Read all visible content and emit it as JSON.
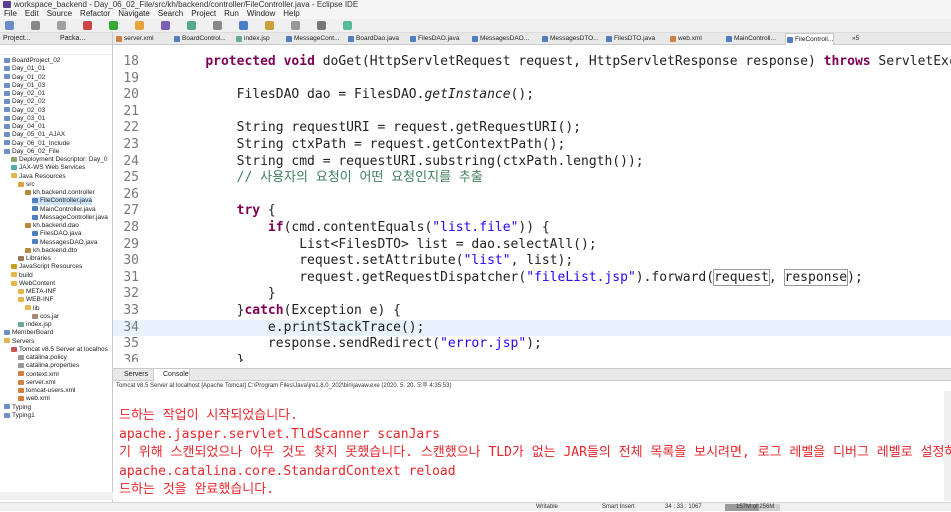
{
  "window": {
    "title": "workspace_backend - Day_06_02_File/src/kh/backend/controller/FileController.java - Eclipse IDE"
  },
  "menubar": [
    "File",
    "Edit",
    "Source",
    "Refactor",
    "Navigate",
    "Search",
    "Project",
    "Run",
    "Window",
    "Help"
  ],
  "left_panel": {
    "tab_project": "Project...",
    "tab_package": "Packa...",
    "tree": [
      {
        "label": "BoardProject_02",
        "depth": 0,
        "icon": "project-icon"
      },
      {
        "label": "Day_01_01",
        "depth": 0,
        "icon": "project-icon"
      },
      {
        "label": "Day_01_02",
        "depth": 0,
        "icon": "project-icon"
      },
      {
        "label": "Day_01_03",
        "depth": 0,
        "icon": "project-icon"
      },
      {
        "label": "Day_02_01",
        "depth": 0,
        "icon": "project-icon"
      },
      {
        "label": "Day_02_02",
        "depth": 0,
        "icon": "project-icon"
      },
      {
        "label": "Day_02_03",
        "depth": 0,
        "icon": "project-icon"
      },
      {
        "label": "Day_03_01",
        "depth": 0,
        "icon": "project-icon"
      },
      {
        "label": "Day_04_01",
        "depth": 0,
        "icon": "project-icon"
      },
      {
        "label": "Day_05_01_AJAX",
        "depth": 0,
        "icon": "project-icon"
      },
      {
        "label": "Day_06_01_Include",
        "depth": 0,
        "icon": "project-icon"
      },
      {
        "label": "Day_06_02_File",
        "depth": 0,
        "icon": "project-icon"
      },
      {
        "label": "Deployment Descriptor: Day_0",
        "depth": 1,
        "icon": "descriptor-icon"
      },
      {
        "label": "JAX-WS Web Services",
        "depth": 1,
        "icon": "webservice-icon"
      },
      {
        "label": "Java Resources",
        "depth": 1,
        "icon": "folder-icon"
      },
      {
        "label": "src",
        "depth": 2,
        "icon": "source-folder-icon"
      },
      {
        "label": "kh.backend.controller",
        "depth": 3,
        "icon": "package-icon"
      },
      {
        "label": "FileController.java",
        "depth": 4,
        "icon": "java-file-icon",
        "selected": true
      },
      {
        "label": "MainController.java",
        "depth": 4,
        "icon": "java-file-icon"
      },
      {
        "label": "MessageController.java",
        "depth": 4,
        "icon": "java-file-icon"
      },
      {
        "label": "kh.backend.dao",
        "depth": 3,
        "icon": "package-icon"
      },
      {
        "label": "FilesDAO.java",
        "depth": 4,
        "icon": "java-file-icon"
      },
      {
        "label": "MessagesDAO.java",
        "depth": 4,
        "icon": "java-file-icon"
      },
      {
        "label": "kh.backend.dto",
        "depth": 3,
        "icon": "package-icon"
      },
      {
        "label": "Libraries",
        "depth": 2,
        "icon": "library-icon"
      },
      {
        "label": "JavaScript Resources",
        "depth": 1,
        "icon": "js-icon"
      },
      {
        "label": "build",
        "depth": 1,
        "icon": "folder-icon"
      },
      {
        "label": "WebContent",
        "depth": 1,
        "icon": "folder-icon"
      },
      {
        "label": "META-INF",
        "depth": 2,
        "icon": "folder-icon"
      },
      {
        "label": "WEB-INF",
        "depth": 2,
        "icon": "folder-icon"
      },
      {
        "label": "lib",
        "depth": 3,
        "icon": "folder-icon"
      },
      {
        "label": "cos.jar",
        "depth": 4,
        "icon": "jar-icon"
      },
      {
        "label": "index.jsp",
        "depth": 2,
        "icon": "jsp-icon"
      },
      {
        "label": "MemberBoard",
        "depth": 0,
        "icon": "project-icon"
      },
      {
        "label": "Servers",
        "depth": 0,
        "icon": "folder-icon"
      },
      {
        "label": "Tomcat v8.5 Server at localhos",
        "depth": 1,
        "icon": "server-icon"
      },
      {
        "label": "catalina.policy",
        "depth": 2,
        "icon": "file-icon"
      },
      {
        "label": "catalina.properties",
        "depth": 2,
        "icon": "file-icon"
      },
      {
        "label": "context.xml",
        "depth": 2,
        "icon": "xml-icon"
      },
      {
        "label": "server.xml",
        "depth": 2,
        "icon": "xml-icon"
      },
      {
        "label": "tomcat-users.xml",
        "depth": 2,
        "icon": "xml-icon"
      },
      {
        "label": "web.xml",
        "depth": 2,
        "icon": "xml-icon"
      },
      {
        "label": "Typing",
        "depth": 0,
        "icon": "project-icon"
      },
      {
        "label": "Typing1",
        "depth": 0,
        "icon": "project-icon"
      }
    ]
  },
  "editor_tabs": [
    {
      "label": "server.xml",
      "icon": "xml-icon"
    },
    {
      "label": "BoardControl...",
      "icon": "java-file-icon"
    },
    {
      "label": "index.jsp",
      "icon": "jsp-icon"
    },
    {
      "label": "MessageCont...",
      "icon": "java-file-icon"
    },
    {
      "label": "BoardDao.java",
      "icon": "java-file-icon"
    },
    {
      "label": "FilesDAO.java",
      "icon": "java-file-icon"
    },
    {
      "label": "MessagesDAO...",
      "icon": "java-file-icon"
    },
    {
      "label": "MessagesDTO...",
      "icon": "java-file-icon"
    },
    {
      "label": "FilesDTO.java",
      "icon": "java-file-icon"
    },
    {
      "label": "web.xml",
      "icon": "xml-icon"
    },
    {
      "label": "MainControll...",
      "icon": "java-file-icon"
    },
    {
      "label": "FileControll...",
      "icon": "java-file-icon",
      "active": true
    },
    {
      "label": "»5",
      "icon": ""
    }
  ],
  "code_lines": [
    {
      "n": "18",
      "segs": [
        [
          "    ",
          ""
        ],
        [
          "protected",
          "kw"
        ],
        [
          " ",
          ""
        ],
        [
          "void",
          "kw"
        ],
        [
          " doGet(HttpServletRequest request, HttpServletResponse response) ",
          ""
        ],
        [
          "throws",
          "kw"
        ],
        [
          " ServletExcepti",
          ""
        ]
      ]
    },
    {
      "n": "19",
      "segs": []
    },
    {
      "n": "20",
      "segs": [
        [
          "        FilesDAO dao = FilesDAO.",
          ""
        ],
        [
          "getInstance",
          "it"
        ],
        [
          "();",
          ""
        ]
      ]
    },
    {
      "n": "21",
      "segs": []
    },
    {
      "n": "22",
      "segs": [
        [
          "        String requestURI = request.getRequestURI();",
          ""
        ]
      ]
    },
    {
      "n": "23",
      "segs": [
        [
          "        String ctxPath = request.getContextPath();",
          ""
        ]
      ]
    },
    {
      "n": "24",
      "segs": [
        [
          "        String cmd = requestURI.substring(ctxPath.length());",
          ""
        ]
      ]
    },
    {
      "n": "25",
      "segs": [
        [
          "        ",
          ""
        ],
        [
          "// 사용자의 요청이 어떤 요청인지를 추출",
          "cm"
        ]
      ]
    },
    {
      "n": "26",
      "segs": []
    },
    {
      "n": "27",
      "segs": [
        [
          "        ",
          ""
        ],
        [
          "try",
          "kw"
        ],
        [
          " {",
          ""
        ]
      ]
    },
    {
      "n": "28",
      "segs": [
        [
          "            ",
          ""
        ],
        [
          "if",
          "kw"
        ],
        [
          "(cmd.contentEquals(",
          ""
        ],
        [
          "\"list.file\"",
          "st"
        ],
        [
          ")) {",
          ""
        ]
      ]
    },
    {
      "n": "29",
      "segs": [
        [
          "                List<FilesDTO> list = dao.selectAll();",
          ""
        ]
      ]
    },
    {
      "n": "30",
      "segs": [
        [
          "                request.setAttribute(",
          ""
        ],
        [
          "\"list\"",
          "st"
        ],
        [
          ", list);",
          ""
        ]
      ]
    },
    {
      "n": "31",
      "segs": [
        [
          "                request.getRequestDispatcher(",
          ""
        ],
        [
          "\"fileList.jsp\"",
          "st"
        ],
        [
          ").forward(",
          ""
        ],
        [
          "request",
          "boxed"
        ],
        [
          ", ",
          ""
        ],
        [
          "response",
          "boxed"
        ],
        [
          ");",
          ""
        ]
      ]
    },
    {
      "n": "32",
      "segs": [
        [
          "            }",
          ""
        ]
      ]
    },
    {
      "n": "33",
      "segs": [
        [
          "        }",
          ""
        ],
        [
          "catch",
          "kw"
        ],
        [
          "(Exception e) {",
          ""
        ]
      ]
    },
    {
      "n": "34",
      "segs": [
        [
          "            e.printStackTrace();",
          ""
        ]
      ],
      "highlight": true
    },
    {
      "n": "35",
      "segs": [
        [
          "            response.sendRedirect(",
          ""
        ],
        [
          "\"error.jsp\"",
          "st"
        ],
        [
          ");",
          ""
        ]
      ]
    },
    {
      "n": "36",
      "segs": [
        [
          "        }",
          ""
        ]
      ]
    }
  ],
  "bottom_panel": {
    "tab_servers": "Servers",
    "tab_console": "Console",
    "status_line": "Tomcat v8.5 Server at localhost [Apache Tomcat] C:\\Program Files\\Java\\jre1.8.0_202\\bin\\javaw.exe (2020. 5. 20. 오후 4:35:53)",
    "output": [
      "드하는 작업이 시작되었습니다.",
      "apache.jasper.servlet.TldScanner scanJars",
      "기 위해 스캔되었으나 아무 것도 찾지 못했습니다. 스캔했으나 TLD가 없는 JAR들의 전체 목록을 보시려면, 로그 레벨을 디버그 레벨로 설정하십시오. 스캔 과",
      "apache.catalina.core.StandardContext reload",
      "드하는 것을 완료했습니다."
    ]
  },
  "statusbar": {
    "writable": "Writable",
    "insert_mode": "Smart Insert",
    "cursor": "34 : 33 : 1067",
    "heap": "157M of 256M",
    "heap_fraction": 0.61
  },
  "colors": {
    "keyword": "#7f0055",
    "string": "#2a00ff",
    "comment": "#3f7f5f",
    "console_err": "#e8262b"
  }
}
